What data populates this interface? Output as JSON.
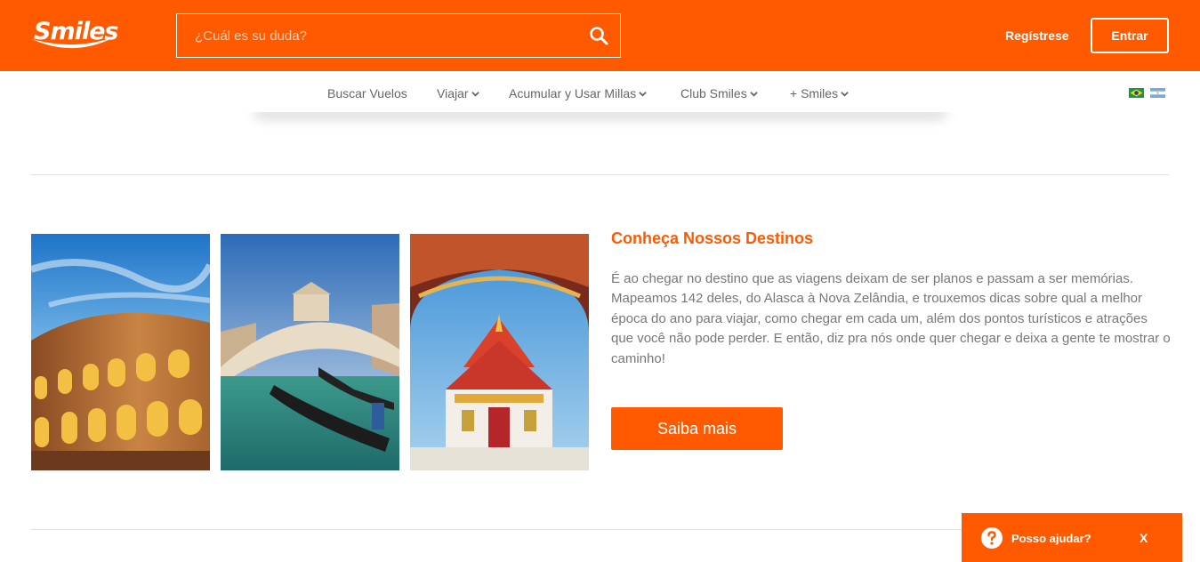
{
  "header": {
    "logo_text": "Smiles",
    "search": {
      "placeholder": "¿Cuál es su duda?",
      "value": ""
    },
    "register_label": "Regístrese",
    "login_label": "Entrar"
  },
  "nav": {
    "items": [
      {
        "label": "Buscar Vuelos",
        "dropdown": false
      },
      {
        "label": "Viajar",
        "dropdown": true
      },
      {
        "label": "Acumular y Usar Millas",
        "dropdown": true
      },
      {
        "label": "Club Smiles",
        "dropdown": true
      },
      {
        "label": "+ Smiles",
        "dropdown": true
      }
    ],
    "flags": [
      "brazil-flag-icon",
      "argentina-flag-icon"
    ]
  },
  "destinations": {
    "title": "Conheça Nossos Destinos",
    "text": "É ao chegar no destino que as viagens deixam de ser planos e passam a ser memórias. Mapeamos 142 deles, do Alasca à Nova Zelândia, e trouxemos dicas sobre qual a melhor época do ano para viajar, como chegar em cada um, além dos pontos turísticos e atrações que você não pode perder. E então, diz pra nós onde quer chegar e deixa a gente te mostrar o caminho!",
    "button_label": "Saiba mais",
    "images": [
      "colosseum-photo",
      "venice-rialto-photo",
      "thai-temple-photo"
    ]
  },
  "help_widget": {
    "label": "Posso ajudar?",
    "close_label": "X"
  },
  "colors": {
    "brand": "#ff5a00",
    "text_gray": "#777777"
  }
}
